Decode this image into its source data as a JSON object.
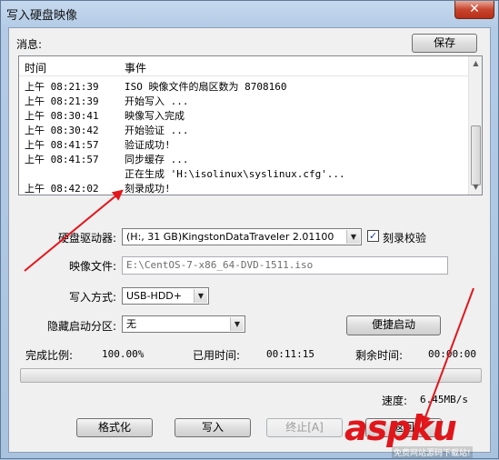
{
  "window": {
    "title": "写入硬盘映像",
    "close_symbol": "✕"
  },
  "messages": {
    "label": "消息:",
    "save_button": "保存",
    "columns": {
      "time": "时间",
      "event": "事件"
    },
    "rows": [
      {
        "time": "上午 08:21:39",
        "event": "ISO 映像文件的扇区数为 8708160"
      },
      {
        "time": "上午 08:21:39",
        "event": "开始写入 ..."
      },
      {
        "time": "上午 08:30:41",
        "event": "映像写入完成"
      },
      {
        "time": "上午 08:30:42",
        "event": "开始验证 ..."
      },
      {
        "time": "上午 08:41:57",
        "event": "验证成功!"
      },
      {
        "time": "上午 08:41:57",
        "event": "同步缓存 ..."
      },
      {
        "time": "",
        "event": "正在生成 'H:\\isolinux\\syslinux.cfg'..."
      },
      {
        "time": "上午 08:42:02",
        "event": "刻录成功!"
      }
    ]
  },
  "form": {
    "drive_label": "硬盘驱动器:",
    "drive_value": "(H:, 31 GB)KingstonDataTraveler 2.01100",
    "verify_label": "刻录校验",
    "verify_checked": true,
    "image_label": "映像文件:",
    "image_value": "E:\\CentOS-7-x86_64-DVD-1511.iso",
    "write_mode_label": "写入方式:",
    "write_mode_value": "USB-HDD+",
    "hidden_partition_label": "隐藏启动分区:",
    "hidden_partition_value": "无",
    "quick_boot_button": "便捷启动"
  },
  "progress": {
    "ratio_label": "完成比例:",
    "ratio_value": "100.00%",
    "elapsed_label": "已用时间:",
    "elapsed_value": "00:11:15",
    "remaining_label": "剩余时间:",
    "remaining_value": "00:00:00",
    "fill_fraction": 0.0,
    "speed_label": "速度:",
    "speed_value": "6.45MB/s"
  },
  "buttons": {
    "format": "格式化",
    "write": "写入",
    "stop": "终止[A]",
    "back": "返回"
  },
  "watermark": {
    "main": "aspku",
    "sub": "免费网站源码下载站!"
  },
  "colors": {
    "annotation_arrow": "#e3161c",
    "progress_fill": "#7ccd61"
  }
}
